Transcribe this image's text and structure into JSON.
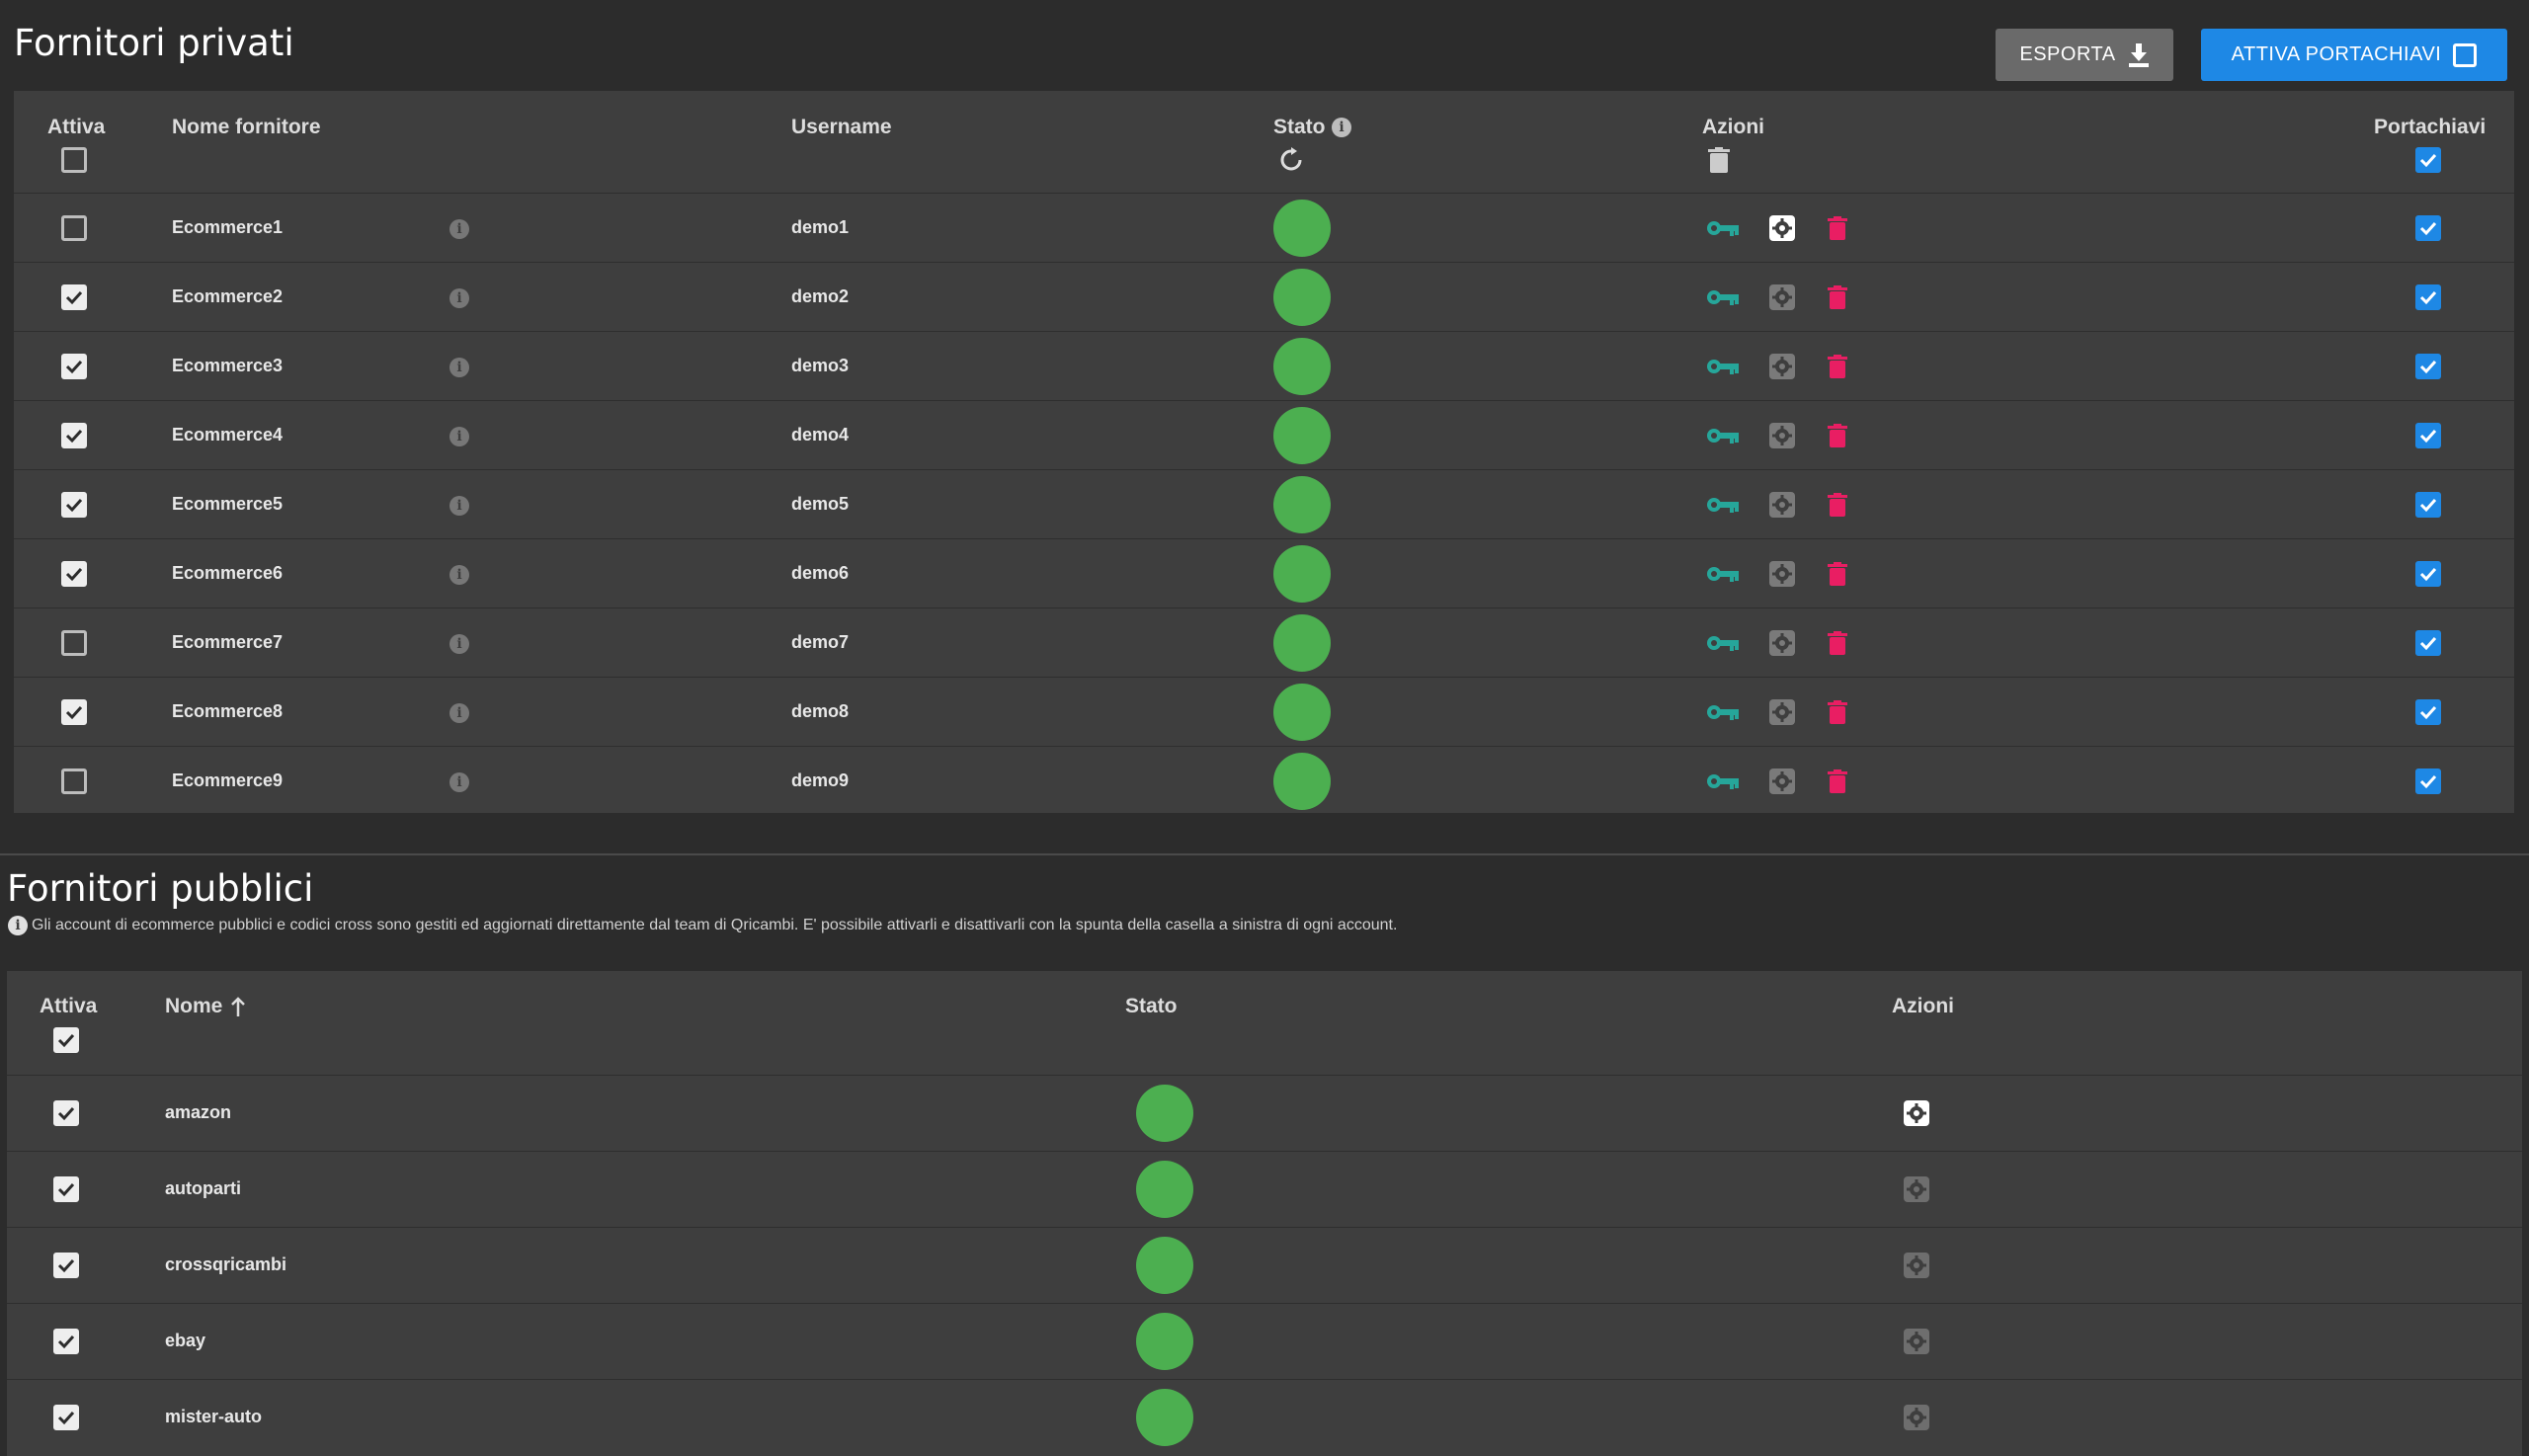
{
  "private": {
    "title": "Fornitori privati",
    "export_label": "ESPORTA",
    "keychain_label": "ATTIVA PORTACHIAVI",
    "headers": {
      "active": "Attiva",
      "name": "Nome fornitore",
      "username": "Username",
      "status": "Stato",
      "actions": "Azioni",
      "keychain": "Portachiavi"
    },
    "rows": [
      {
        "name": "Ecommerce1",
        "username": "demo1",
        "active": false,
        "keychain": true
      },
      {
        "name": "Ecommerce2",
        "username": "demo2",
        "active": true,
        "keychain": true
      },
      {
        "name": "Ecommerce3",
        "username": "demo3",
        "active": true,
        "keychain": true
      },
      {
        "name": "Ecommerce4",
        "username": "demo4",
        "active": true,
        "keychain": true
      },
      {
        "name": "Ecommerce5",
        "username": "demo5",
        "active": true,
        "keychain": true
      },
      {
        "name": "Ecommerce6",
        "username": "demo6",
        "active": true,
        "keychain": true
      },
      {
        "name": "Ecommerce7",
        "username": "demo7",
        "active": false,
        "keychain": true
      },
      {
        "name": "Ecommerce8",
        "username": "demo8",
        "active": true,
        "keychain": true
      },
      {
        "name": "Ecommerce9",
        "username": "demo9",
        "active": false,
        "keychain": true
      }
    ]
  },
  "public": {
    "title": "Fornitori pubblici",
    "note": "Gli account di ecommerce pubblici e codici cross sono gestiti ed aggiornati direttamente dal team di Qricambi. E' possibile attivarli e disattivarli con la spunta della casella a sinistra di ogni account.",
    "headers": {
      "active": "Attiva",
      "name": "Nome",
      "status": "Stato",
      "actions": "Azioni"
    },
    "rows": [
      {
        "name": "amazon",
        "active": true
      },
      {
        "name": "autoparti",
        "active": true
      },
      {
        "name": "crossqricambi",
        "active": true
      },
      {
        "name": "ebay",
        "active": true
      },
      {
        "name": "mister-auto",
        "active": true
      }
    ]
  },
  "colors": {
    "accent": "#1e88e5",
    "status_ok": "#4caf50",
    "key": "#26a69a",
    "delete": "#e91e63"
  }
}
